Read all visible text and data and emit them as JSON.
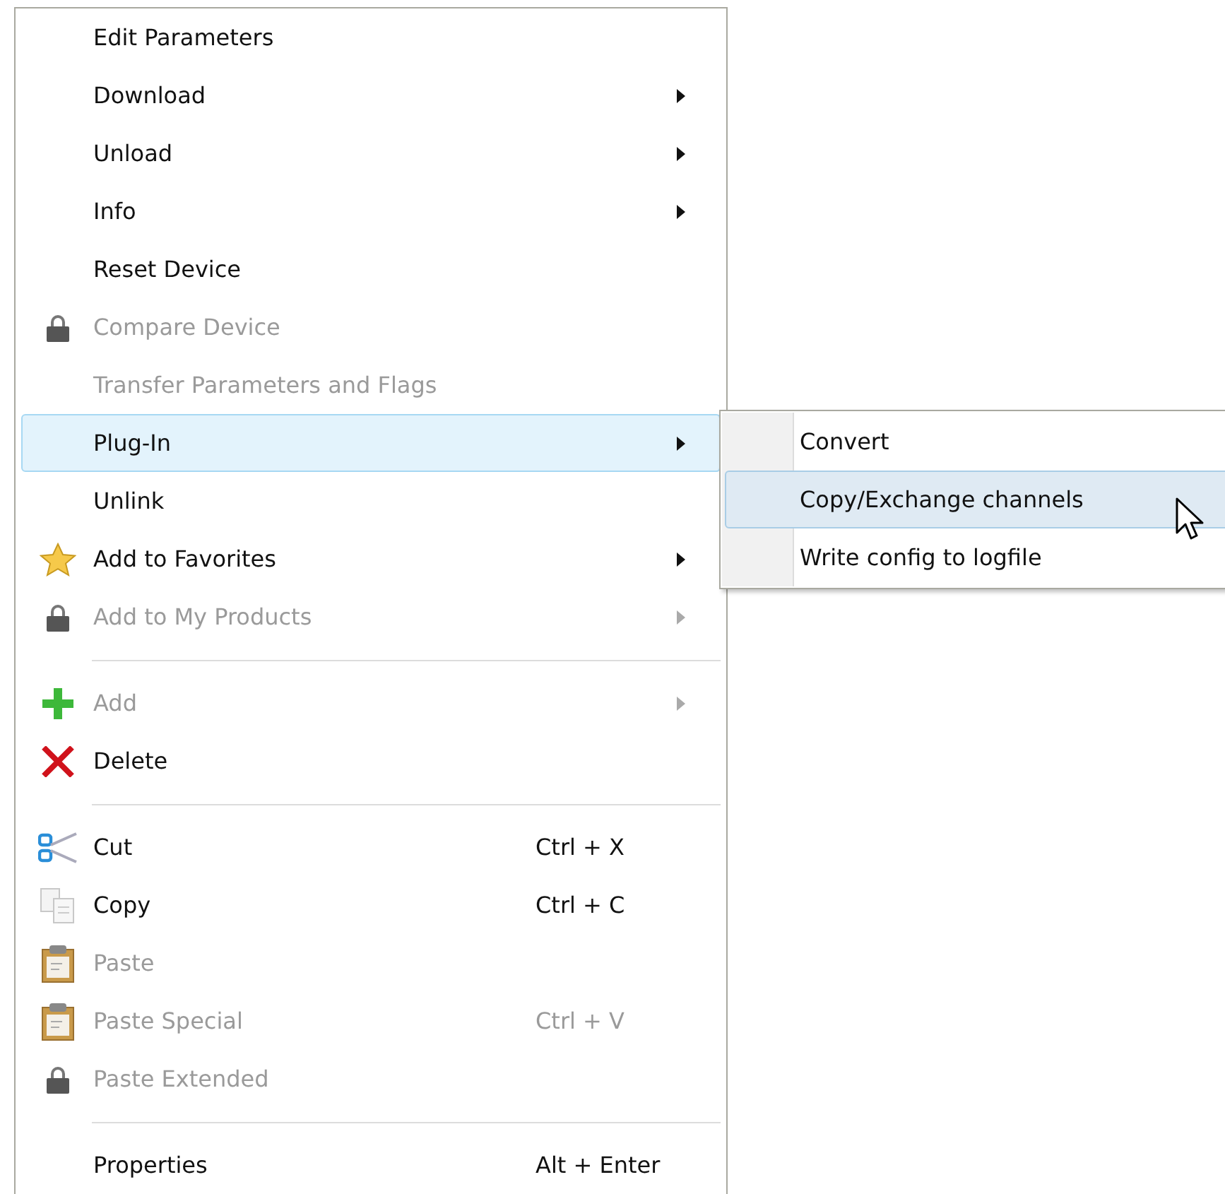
{
  "menu": {
    "items": [
      {
        "kind": "plain",
        "label": "Edit Parameters",
        "disabled": false,
        "submenu": false,
        "selected": false
      },
      {
        "kind": "plain",
        "label": "Download",
        "disabled": false,
        "submenu": true,
        "selected": false
      },
      {
        "kind": "plain",
        "label": "Unload",
        "disabled": false,
        "submenu": true,
        "selected": false
      },
      {
        "kind": "plain",
        "label": "Info",
        "disabled": false,
        "submenu": true,
        "selected": false
      },
      {
        "kind": "plain",
        "label": "Reset Device",
        "disabled": false,
        "submenu": false,
        "selected": false
      },
      {
        "kind": "lock",
        "label": "Compare Device",
        "disabled": true,
        "submenu": false,
        "selected": false
      },
      {
        "kind": "plain",
        "label": "Transfer Parameters and Flags",
        "disabled": true,
        "submenu": false,
        "selected": false
      },
      {
        "kind": "plain",
        "label": "Plug-In",
        "disabled": false,
        "submenu": true,
        "selected": true
      },
      {
        "kind": "plain",
        "label": "Unlink",
        "disabled": false,
        "submenu": false,
        "selected": false
      },
      {
        "kind": "star",
        "label": "Add to Favorites",
        "disabled": false,
        "submenu": true,
        "selected": false
      },
      {
        "kind": "lock",
        "label": "Add to My Products",
        "disabled": true,
        "submenu": true,
        "selected": false
      },
      {
        "kind": "separator"
      },
      {
        "kind": "plus",
        "label": "Add",
        "disabled": true,
        "submenu": true,
        "selected": false
      },
      {
        "kind": "delete",
        "label": "Delete",
        "disabled": false,
        "submenu": false,
        "selected": false
      },
      {
        "kind": "separator"
      },
      {
        "kind": "cut",
        "label": "Cut",
        "disabled": false,
        "submenu": false,
        "selected": false,
        "shortcut": "Ctrl + X"
      },
      {
        "kind": "copy",
        "label": "Copy",
        "disabled": false,
        "submenu": false,
        "selected": false,
        "shortcut": "Ctrl + C"
      },
      {
        "kind": "paste",
        "label": "Paste",
        "disabled": true,
        "submenu": false,
        "selected": false
      },
      {
        "kind": "paste",
        "label": "Paste Special",
        "disabled": true,
        "submenu": false,
        "selected": false,
        "shortcut": "Ctrl + V"
      },
      {
        "kind": "lock",
        "label": "Paste Extended",
        "disabled": true,
        "submenu": false,
        "selected": false
      },
      {
        "kind": "separator"
      },
      {
        "kind": "plain",
        "label": "Properties",
        "disabled": false,
        "submenu": false,
        "selected": false,
        "shortcut": "Alt + Enter"
      }
    ]
  },
  "submenu": {
    "items": [
      {
        "label": "Convert",
        "selected": false
      },
      {
        "label": "Copy/Exchange channels",
        "selected": true
      },
      {
        "label": "Write config to logfile",
        "selected": false
      }
    ]
  }
}
